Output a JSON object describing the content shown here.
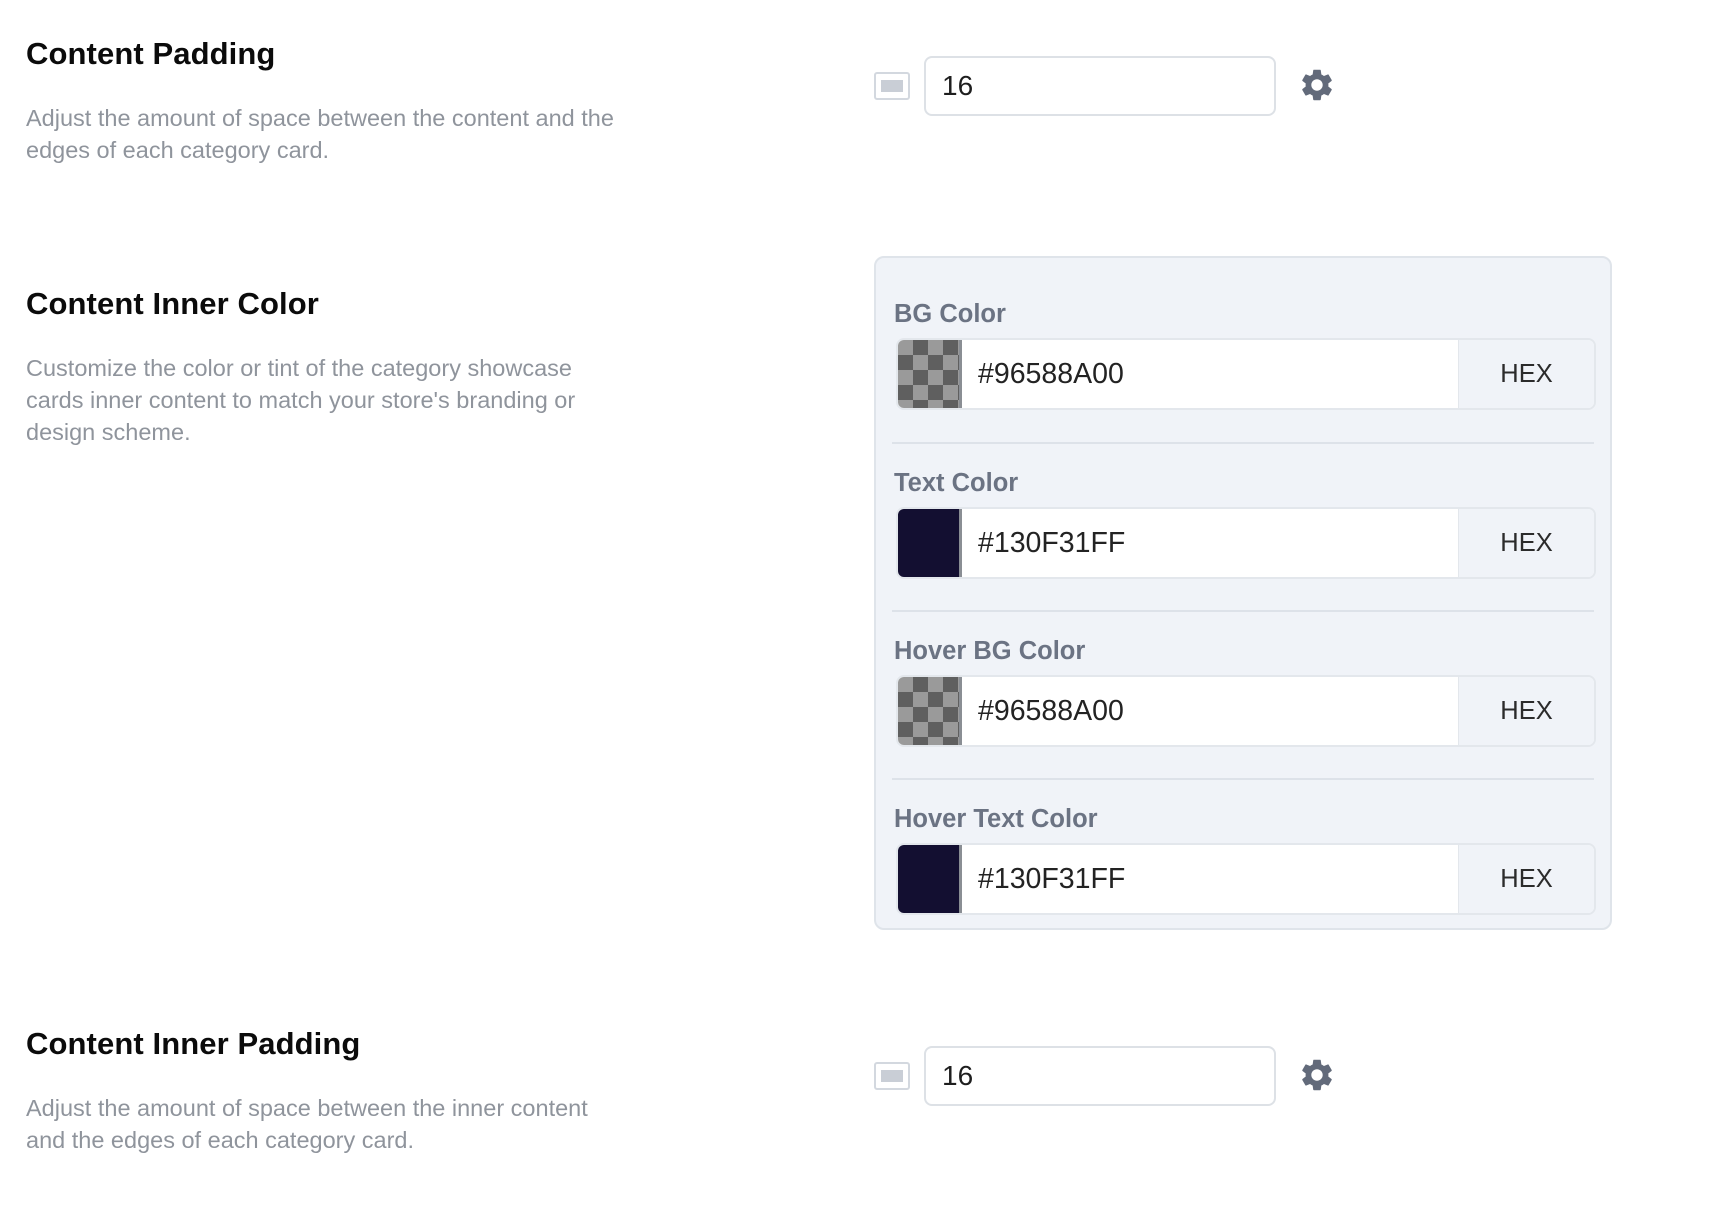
{
  "content_padding": {
    "title": "Content Padding",
    "description": "Adjust the amount of space between the content and the edges of each category card.",
    "value": "16",
    "device_icon": "desktop-icon",
    "settings_icon": "gear-icon"
  },
  "content_inner_color": {
    "title": "Content Inner Color",
    "description": "Customize the color or tint of the category showcase cards inner content to match your store's branding or design scheme.",
    "colors": [
      {
        "label": "BG Color",
        "value": "#96588A00",
        "mode": "HEX",
        "swatch": "transparent"
      },
      {
        "label": "Text Color",
        "value": "#130F31FF",
        "mode": "HEX",
        "swatch": "#130F31"
      },
      {
        "label": "Hover BG Color",
        "value": "#96588A00",
        "mode": "HEX",
        "swatch": "transparent"
      },
      {
        "label": "Hover Text Color",
        "value": "#130F31FF",
        "mode": "HEX",
        "swatch": "#130F31"
      }
    ]
  },
  "content_inner_padding": {
    "title": "Content Inner Padding",
    "description": "Adjust the amount of space between the inner content and the edges of each category card.",
    "value": "16",
    "device_icon": "desktop-icon",
    "settings_icon": "gear-icon"
  },
  "theme": {
    "title_color": "#0b0b0b",
    "description_color": "#8f949c",
    "panel_bg": "#f0f3f8",
    "label_color": "#6b7383",
    "gear_color": "#626a7a"
  }
}
